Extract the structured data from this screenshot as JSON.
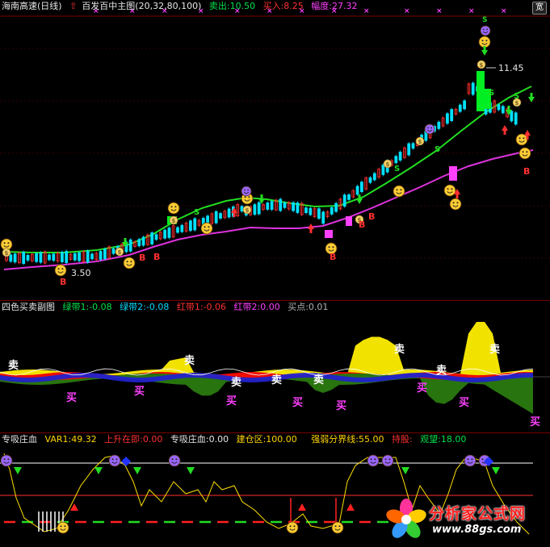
{
  "panel_main": {
    "stock_name": "海南高速(日线)",
    "indicator_name": "百发百中主图(20,32,80,100)",
    "sell_label": "卖出:10.50",
    "buy_label": "买入:8.25",
    "amplitude_label": "幅度:27.32",
    "high_price_label": "11.45",
    "low_price_label": "3.50",
    "sell_mark": "S",
    "buy_mark": "B",
    "colors": {
      "upper_band": "#22dd22",
      "lower_band": "#dd33dd",
      "up_candle": "#ff3030",
      "down_candle": "#00e0ff"
    }
  },
  "panel_sub": {
    "title": "四色买卖副图",
    "green1": "绿带1:-0.08",
    "green2": "绿带2:-0.08",
    "red1": "红带1:-0.06",
    "red2": "红带2:0.00",
    "buy_point": "买点:0.01",
    "sell_word": "卖",
    "buy_word": "买"
  },
  "panel_bottom": {
    "title": "专吸庄血",
    "var1": "VAR1:49.32",
    "rise": "上升在即:0.00",
    "blood": "专吸庄血:0.00",
    "build": "建仓区:100.00",
    "strong": "强弱分界线:55.00",
    "hold": "持股:",
    "watch": "观望:18.00"
  },
  "toolbar": {
    "wide_label": "宽"
  },
  "watermark": {
    "name": "分析家公式网",
    "url": "www.88gs.com"
  }
}
